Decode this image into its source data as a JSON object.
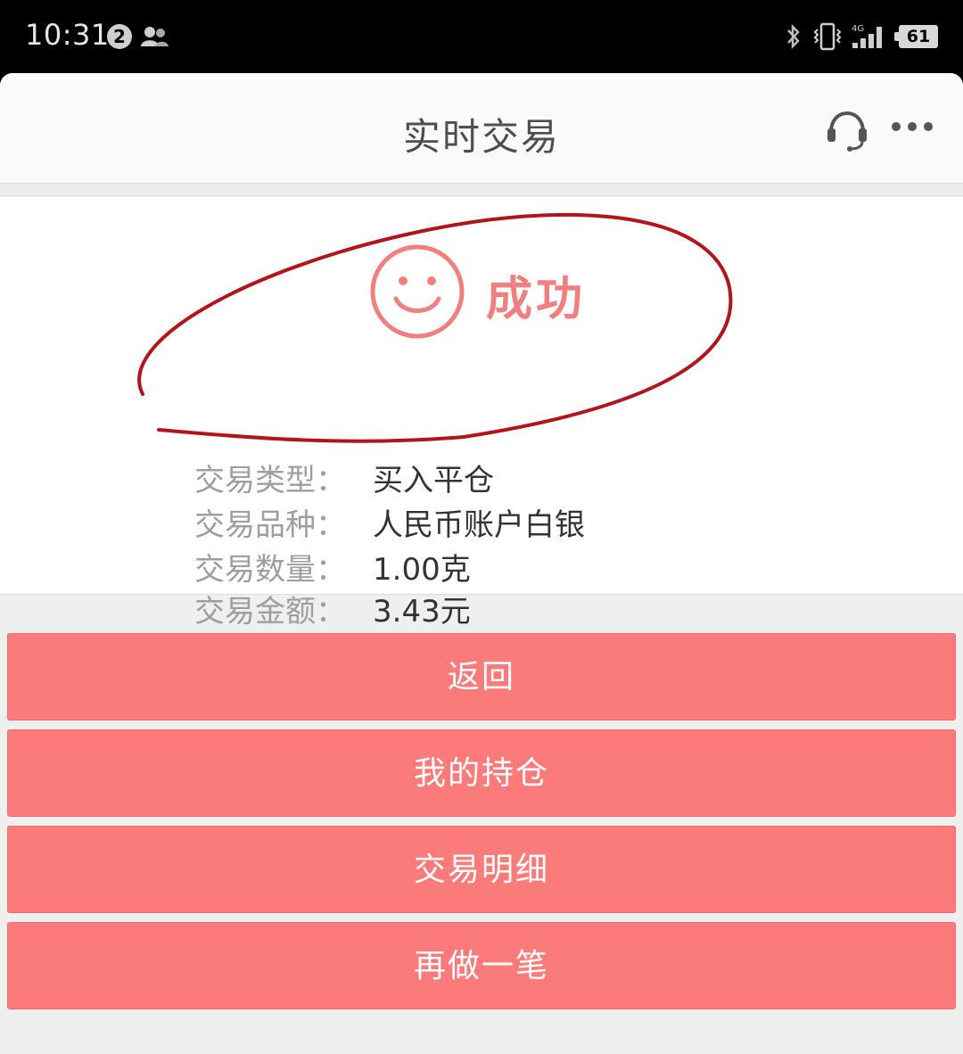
{
  "status_bar": {
    "time": "10:31",
    "notification_count": "2",
    "signal_label": "4G",
    "battery": "61"
  },
  "header": {
    "title": "实时交易"
  },
  "result": {
    "status": "成功",
    "details": [
      {
        "label": "交易类型：",
        "value": "买入平仓"
      },
      {
        "label": "交易品种：",
        "value": "人民币账户白银"
      },
      {
        "label": "交易数量：",
        "value": "1.00克"
      },
      {
        "label": "交易金额：",
        "value": "3.43元"
      }
    ]
  },
  "actions": {
    "back": "返回",
    "my_positions": "我的持仓",
    "trade_details": "交易明细",
    "trade_again": "再做一笔"
  },
  "colors": {
    "accent": "#fb7b7b",
    "success": "#f08080",
    "annotation": "#b3141c"
  }
}
